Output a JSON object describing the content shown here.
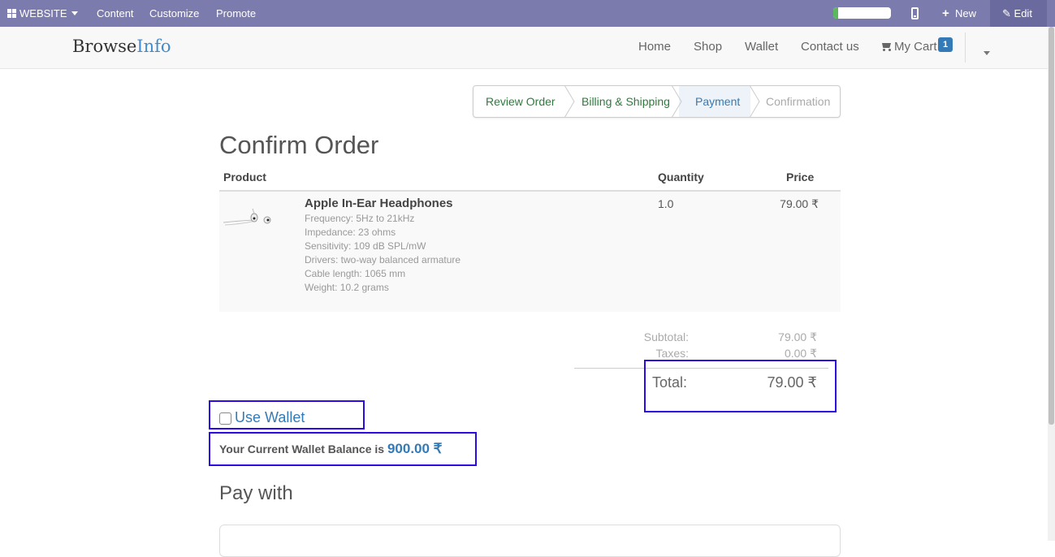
{
  "adminbar": {
    "website_label": "WEBSITE",
    "content_label": "Content",
    "customize_label": "Customize",
    "promote_label": "Promote",
    "new_label": "New",
    "edit_label": "Edit",
    "bar_color": "#7C7BAD"
  },
  "header": {
    "logo_part1": "Browse",
    "logo_part2": "Info",
    "nav": {
      "home": "Home",
      "shop": "Shop",
      "wallet": "Wallet",
      "contact": "Contact us",
      "cart": "My Cart",
      "cart_count": "1"
    }
  },
  "wizard": {
    "steps": [
      {
        "label": "Review Order",
        "state": "done"
      },
      {
        "label": "Billing & Shipping",
        "state": "done"
      },
      {
        "label": "Payment",
        "state": "active"
      },
      {
        "label": "Confirmation",
        "state": "todo"
      }
    ]
  },
  "order": {
    "title": "Confirm Order",
    "columns": {
      "product": "Product",
      "quantity": "Quantity",
      "price": "Price"
    },
    "items": [
      {
        "name": "Apple In-Ear Headphones",
        "description": [
          "Frequency: 5Hz to 21kHz",
          "Impedance: 23 ohms",
          "Sensitivity: 109 dB SPL/mW",
          "Drivers: two-way balanced armature",
          "Cable length: 1065 mm",
          "Weight: 10.2 grams"
        ],
        "quantity": "1.0",
        "price": "79.00 ₹"
      }
    ],
    "subtotal_label": "Subtotal:",
    "subtotal_value": "79.00 ₹",
    "taxes_label": "Taxes:",
    "taxes_value": "0.00 ₹",
    "total_label": "Total:",
    "total_value": "79.00 ₹"
  },
  "wallet": {
    "use_wallet_label": "Use Wallet",
    "use_wallet_checked": false,
    "balance_text": "Your Current Wallet Balance is",
    "balance_value": "900.00 ₹"
  },
  "payment": {
    "pay_with_label": "Pay with"
  },
  "highlight_color": "#2b0be0"
}
